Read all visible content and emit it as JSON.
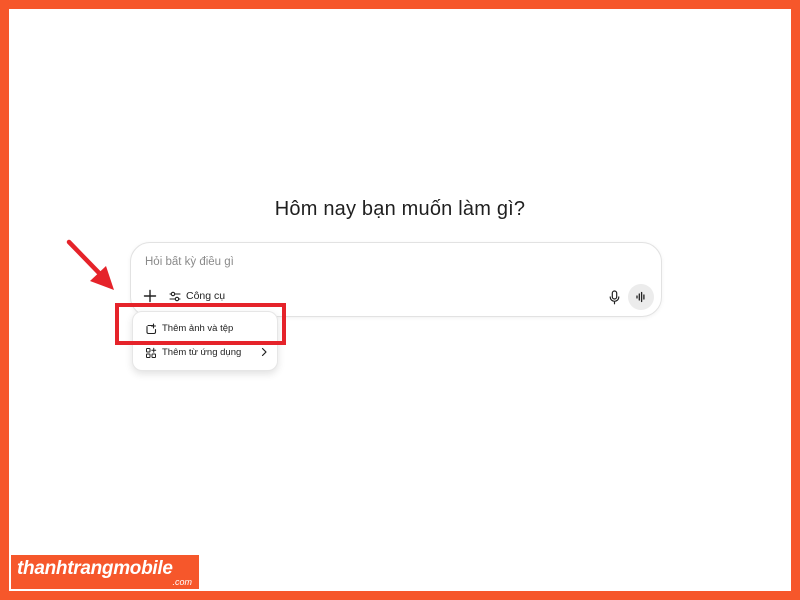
{
  "heading": "Hôm nay bạn muốn làm gì?",
  "composer": {
    "placeholder": "Hỏi bất kỳ điều gì",
    "value": "",
    "tools_label": "Công cụ",
    "icons": {
      "add": "plus-icon",
      "tools": "sliders-icon",
      "mic": "microphone-icon",
      "voice": "voice-waveform-icon"
    }
  },
  "menu": {
    "items": [
      {
        "label": "Thêm ảnh và tệp",
        "icon": "paperclip-icon"
      },
      {
        "label": "Thêm từ ứng dụng",
        "icon": "apps-icon",
        "has_submenu": true
      }
    ]
  },
  "annotation": {
    "arrow_color": "#e5232a",
    "box_color": "#e5232a"
  },
  "watermark": {
    "main": "thanhtrangmobile",
    "sub": ".com"
  },
  "colors": {
    "border": "#f6572b",
    "background": "#ffffff"
  }
}
